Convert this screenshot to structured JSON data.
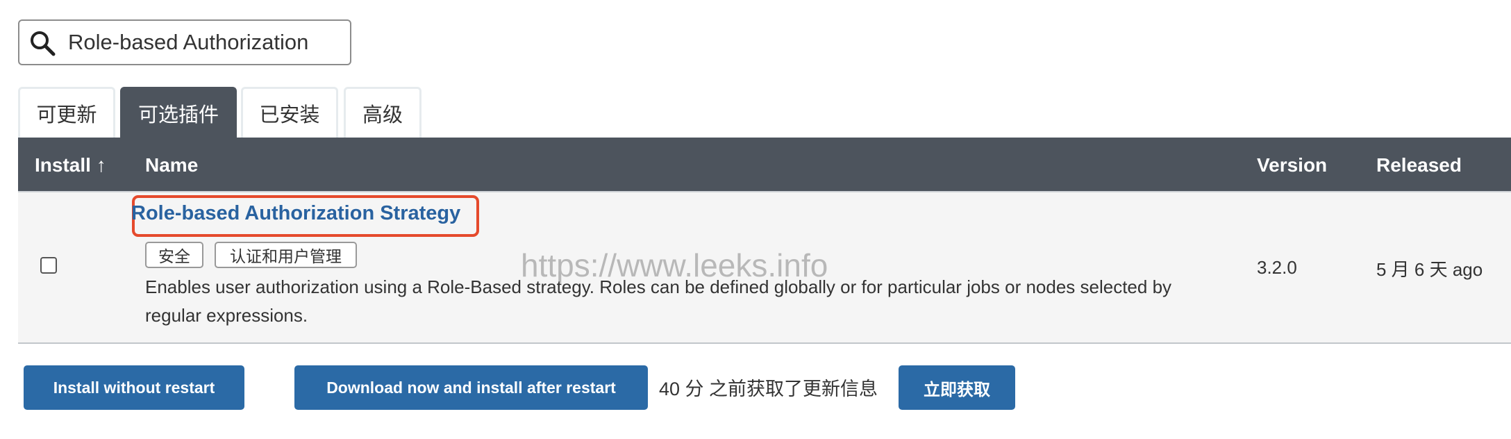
{
  "search": {
    "value": "Role-based Authorization",
    "icon": "search-icon"
  },
  "tabs": [
    {
      "label": "可更新",
      "active": false
    },
    {
      "label": "可选插件",
      "active": true
    },
    {
      "label": "已安装",
      "active": false
    },
    {
      "label": "高级",
      "active": false
    }
  ],
  "table": {
    "headers": {
      "install": "Install ↑",
      "name": "Name",
      "version": "Version",
      "released": "Released"
    },
    "rows": [
      {
        "name": "Role-based Authorization Strategy",
        "tags": [
          "安全",
          "认证和用户管理"
        ],
        "description": "Enables user authorization using a Role-Based strategy. Roles can be defined globally or for particular jobs or nodes selected by regular expressions.",
        "version": "3.2.0",
        "released": "5 月 6 天 ago",
        "checked": false,
        "highlighted": true
      }
    ]
  },
  "watermark": "https://www.leeks.info",
  "actions": {
    "install_without_restart": "Install without restart",
    "download_and_install": "Download now and install after restart",
    "status": "40 分 之前获取了更新信息",
    "fetch_now": "立即获取"
  },
  "colors": {
    "header_bg": "#4d545d",
    "link": "#2962a0",
    "button": "#2b6aa6",
    "highlight_border": "#e54a2c"
  }
}
